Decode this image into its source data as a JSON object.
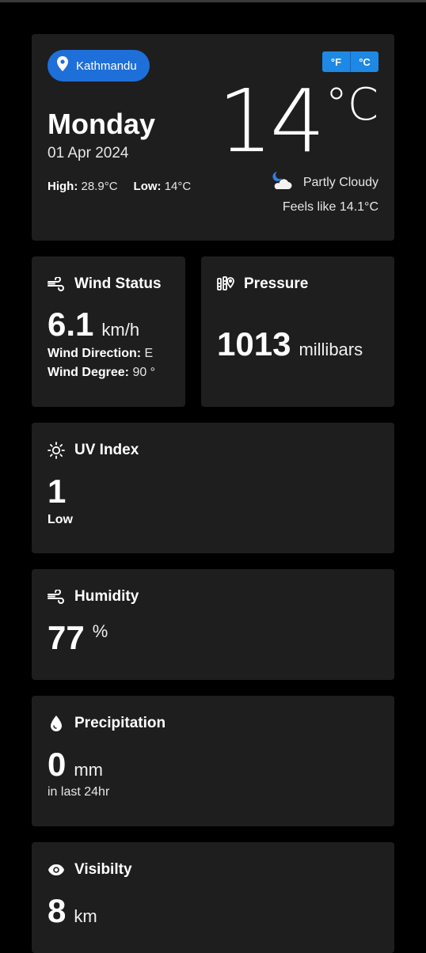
{
  "location": {
    "name": "Kathmandu"
  },
  "units": {
    "fahrenheit_label": "°F",
    "celsius_label": "°C"
  },
  "today": {
    "day": "Monday",
    "date": "01 Apr 2024",
    "high_label": "High:",
    "high_value": "28.9°C",
    "low_label": "Low:",
    "low_value": "14°C",
    "temperature": "14",
    "temperature_unit": "°C",
    "condition": "Partly Cloudy",
    "feels_like": "Feels like 14.1°C"
  },
  "wind": {
    "title": "Wind Status",
    "speed": "6.1",
    "unit": "km/h",
    "direction_label": "Wind Direction:",
    "direction_value": "E",
    "degree_label": "Wind Degree:",
    "degree_value": "90 °"
  },
  "pressure": {
    "title": "Pressure",
    "value": "1013",
    "unit": "millibars"
  },
  "uv": {
    "title": "UV Index",
    "value": "1",
    "level": "Low"
  },
  "humidity": {
    "title": "Humidity",
    "value": "77",
    "unit": "%"
  },
  "precipitation": {
    "title": "Precipitation",
    "value": "0",
    "unit": "mm",
    "note": "in last 24hr"
  },
  "visibility": {
    "title": "Visibilty",
    "value": "8",
    "unit": "km"
  },
  "colors": {
    "background": "#000000",
    "card": "#1e1e1e",
    "accent": "#1e6fd9",
    "toggle": "#1e88e5"
  }
}
